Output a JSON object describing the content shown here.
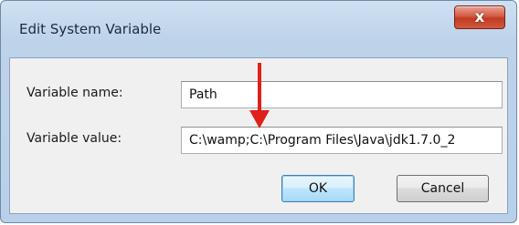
{
  "window": {
    "title": "Edit System Variable",
    "close_glyph": "x"
  },
  "form": {
    "name_label": "Variable name:",
    "name_value": "Path",
    "value_label": "Variable value:",
    "value_value": "C:\\wamp;C:\\Program Files\\Java\\jdk1.7.0_2"
  },
  "buttons": {
    "ok_label": "OK",
    "cancel_label": "Cancel"
  },
  "annotation": {
    "arrow_color": "#e0201b"
  }
}
